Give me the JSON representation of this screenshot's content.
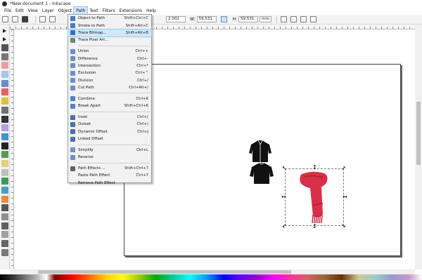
{
  "window": {
    "title": "*New document 1 - Inkscape",
    "icon": "inkscape-icon"
  },
  "menubar": [
    "File",
    "Edit",
    "View",
    "Layer",
    "Object",
    "Path",
    "Text",
    "Filters",
    "Extensions",
    "Help"
  ],
  "active_menu": "Path",
  "commandbar": {
    "x_value": "2.002",
    "w_label": "W:",
    "w_value": "59.531",
    "h_label": "H:",
    "h_value": "59.531",
    "unit": "mm"
  },
  "path_menu": {
    "items": [
      {
        "label": "Object to Path",
        "shortcut": "Shift+Ctrl+C",
        "icon": "object-to-path-icon"
      },
      {
        "label": "Stroke to Path",
        "shortcut": "Shift+Alt+C",
        "icon": "stroke-to-path-icon"
      },
      {
        "label": "Trace Bitmap...",
        "shortcut": "Shift+Alt+B",
        "icon": "trace-bitmap-icon",
        "highlighted": true
      },
      {
        "label": "Trace Pixel Art...",
        "shortcut": "",
        "icon": "trace-pixel-art-icon"
      },
      {
        "sep": true
      },
      {
        "label": "Union",
        "shortcut": "Ctrl++",
        "icon": "union-icon"
      },
      {
        "label": "Difference",
        "shortcut": "Ctrl+-",
        "icon": "difference-icon"
      },
      {
        "label": "Intersection",
        "shortcut": "Ctrl+*",
        "icon": "intersection-icon"
      },
      {
        "label": "Exclusion",
        "shortcut": "Ctrl+^",
        "icon": "exclusion-icon"
      },
      {
        "label": "Division",
        "shortcut": "Ctrl+/",
        "icon": "division-icon"
      },
      {
        "label": "Cut Path",
        "shortcut": "Ctrl+Alt+/",
        "icon": "cut-path-icon"
      },
      {
        "sep": true
      },
      {
        "label": "Combine",
        "shortcut": "Ctrl+K",
        "icon": "combine-icon"
      },
      {
        "label": "Break Apart",
        "shortcut": "Shift+Ctrl+K",
        "icon": "break-apart-icon"
      },
      {
        "sep": true
      },
      {
        "label": "Inset",
        "shortcut": "Ctrl+(",
        "icon": "inset-icon"
      },
      {
        "label": "Outset",
        "shortcut": "Ctrl+)",
        "icon": "outset-icon"
      },
      {
        "label": "Dynamic Offset",
        "shortcut": "Ctrl+J",
        "icon": "dynamic-offset-icon"
      },
      {
        "label": "Linked Offset",
        "shortcut": "",
        "icon": "linked-offset-icon"
      },
      {
        "sep": true
      },
      {
        "label": "Simplify",
        "shortcut": "Ctrl+L",
        "icon": "simplify-icon"
      },
      {
        "label": "Reverse",
        "shortcut": "",
        "icon": "reverse-icon"
      },
      {
        "sep": true
      },
      {
        "label": "Path Effects ...",
        "shortcut": "Shift+Ctrl+7",
        "icon": "path-effects-icon"
      },
      {
        "label": "Paste Path Effect",
        "shortcut": "Ctrl+7",
        "icon": ""
      },
      {
        "label": "Remove Path Effect",
        "shortcut": "",
        "icon": ""
      }
    ]
  },
  "canvas": {
    "objects": [
      "jacket-icon",
      "sweater-icon",
      "red-scarf"
    ],
    "scarf_color": "#d9304a",
    "scarf_fringe_color": "#b8233a"
  },
  "colors": {
    "menu_highlight": "#cde8ff",
    "tool_colors": [
      "#222222",
      "#222222",
      "#555555",
      "#777777",
      "#e8a0a0",
      "#a6c8ee",
      "#6a8fc7",
      "#e86060",
      "#e0c040",
      "#707070",
      "#333333",
      "#b9a0e0",
      "#4a90d0",
      "#222222",
      "#50a050",
      "#e0d080",
      "#c0c0c0",
      "#3a9a5a",
      "#4aa0c0",
      "#e09040",
      "#555555",
      "#909090",
      "#606060",
      "#a0a0a0",
      "#666666",
      "#7a7a7a"
    ]
  }
}
